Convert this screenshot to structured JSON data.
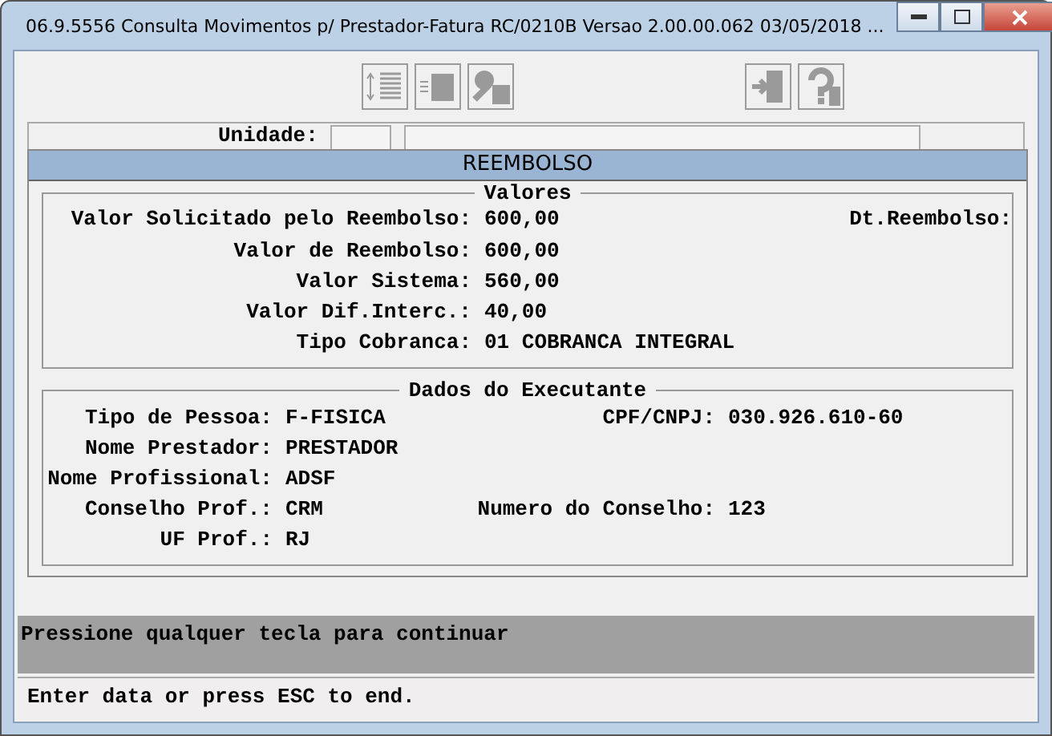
{
  "window": {
    "title": "06.9.5556 Consulta Movimentos p/ Prestador-Fatura RC/0210B Versao 2.00.00.062 03/05/2018 ..."
  },
  "toolbar": {
    "left_buttons": [
      {
        "kind": "sort"
      },
      {
        "kind": "list"
      },
      {
        "kind": "key"
      }
    ],
    "right_buttons": [
      {
        "kind": "exit"
      },
      {
        "kind": "help"
      }
    ]
  },
  "form": {
    "label": "Unidade:"
  },
  "dialog": {
    "title": "REEMBOLSO",
    "sections": [
      {
        "kind": "values",
        "title": "Valores",
        "rows": [
          {
            "fields": [
              {
                "label": "Valor Solicitado pelo Reembolso:",
                "value": "600,00"
              },
              {
                "label": "Dt.Reembolso:"
              }
            ]
          },
          {
            "fields": [
              {
                "label": "Valor de Reembolso:",
                "value": "600,00"
              }
            ]
          },
          {
            "fields": [
              {
                "label": "Valor Sistema:",
                "value": "560,00"
              }
            ]
          },
          {
            "fields": [
              {
                "label": "Valor Dif.Interc.:",
                "value": "40,00"
              }
            ]
          },
          {
            "fields": [
              {
                "label": "Tipo Cobranca:",
                "value": "01 COBRANCA INTEGRAL"
              }
            ]
          }
        ]
      },
      {
        "kind": "executor",
        "title": "Dados do Executante",
        "rows": [
          {
            "fields": [
              {
                "label": "Tipo de Pessoa:",
                "value": "F-FISICA"
              },
              {
                "label": "CPF/CNPJ:",
                "value": "030.926.610-60"
              }
            ]
          },
          {
            "fields": [
              {
                "label": "Nome Prestador:",
                "value": "PRESTADOR"
              }
            ]
          },
          {
            "fields": [
              {
                "label": "Nome Profissional:",
                "value": "ADSF"
              }
            ]
          },
          {
            "fields": [
              {
                "label": "Conselho Prof.:",
                "value": "CRM"
              },
              {
                "label": "Numero do Conselho:",
                "value": "123"
              }
            ]
          },
          {
            "fields": [
              {
                "label": "UF Prof.:",
                "value": "RJ"
              }
            ]
          }
        ]
      }
    ]
  },
  "message": "Pressione qualquer tecla para continuar",
  "status_bar": "Enter data or press ESC to end."
}
